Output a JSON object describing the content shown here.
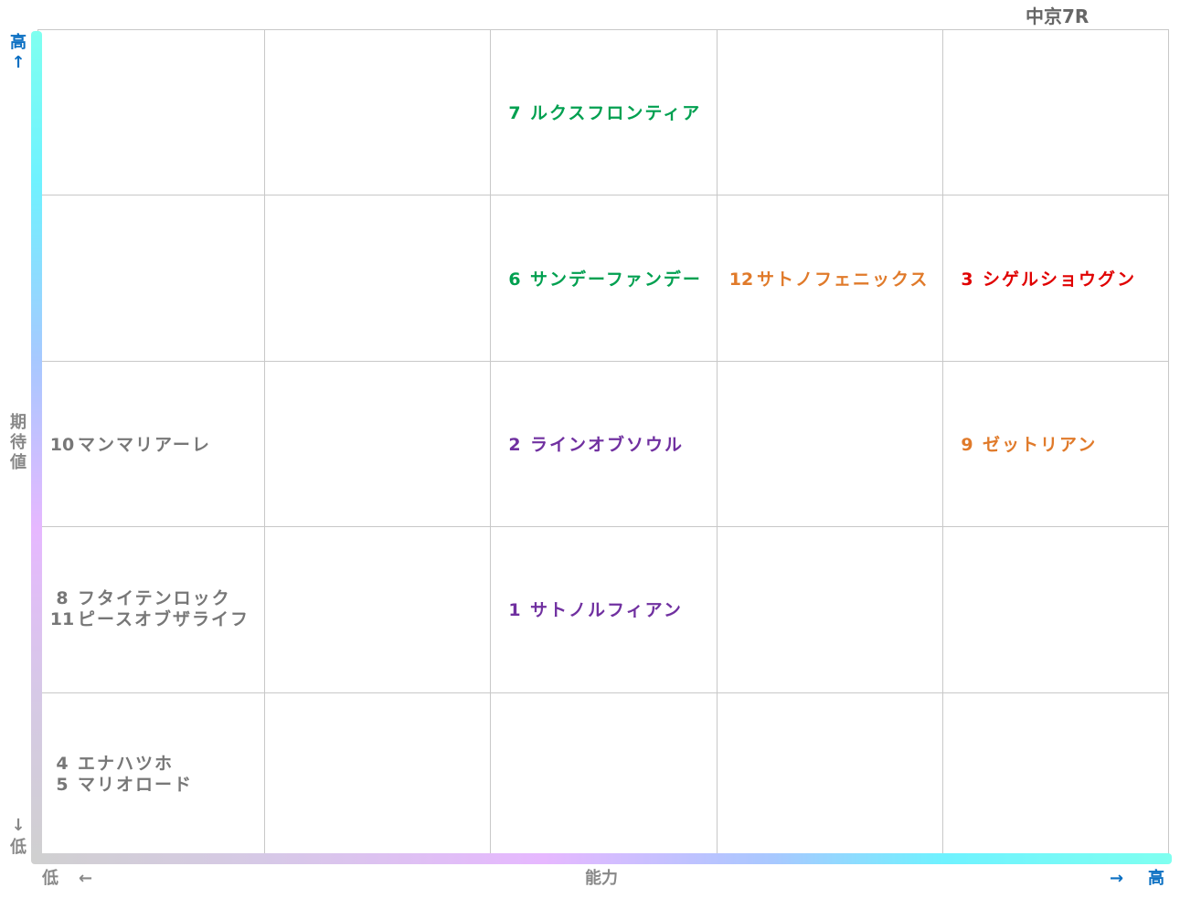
{
  "title": "中京7R",
  "y_axis": {
    "high": "高↑",
    "label": [
      "期",
      "待",
      "値"
    ],
    "low_arrow": "↓",
    "low": "低"
  },
  "x_axis": {
    "low": "低",
    "low_arrow": "←",
    "label": "能力",
    "high_arrow": "→",
    "high": "高"
  },
  "colors": {
    "gray": "#777777",
    "purple": "#7030a0",
    "green": "#00a050",
    "orange": "#e07a2a",
    "red": "#e00000"
  },
  "chart_data": {
    "type": "table",
    "x_label": "能力",
    "y_label": "期待値",
    "columns": 5,
    "rows": 5,
    "entries": [
      {
        "number": "7",
        "name": "ルクスフロンティア",
        "col": 3,
        "row": 5,
        "line": 0,
        "color": "green"
      },
      {
        "number": "6",
        "name": "サンデーファンデー",
        "col": 3,
        "row": 4,
        "line": 0,
        "color": "green"
      },
      {
        "number": "12",
        "name": "サトノフェニックス",
        "col": 4,
        "row": 4,
        "line": 0,
        "color": "orange"
      },
      {
        "number": "3",
        "name": "シゲルショウグン",
        "col": 5,
        "row": 4,
        "line": 0,
        "color": "red"
      },
      {
        "number": "10",
        "name": "マンマリアーレ",
        "col": 1,
        "row": 3,
        "line": 0,
        "color": "gray"
      },
      {
        "number": "2",
        "name": "ラインオブソウル",
        "col": 3,
        "row": 3,
        "line": 0,
        "color": "purple"
      },
      {
        "number": "9",
        "name": "ゼットリアン",
        "col": 5,
        "row": 3,
        "line": 0,
        "color": "orange"
      },
      {
        "number": "8",
        "name": "フタイテンロック",
        "col": 1,
        "row": 2,
        "line": 0,
        "color": "gray"
      },
      {
        "number": "11",
        "name": "ピースオブザライフ",
        "col": 1,
        "row": 2,
        "line": 1,
        "color": "gray"
      },
      {
        "number": "1",
        "name": "サトノルフィアン",
        "col": 3,
        "row": 2,
        "line": 0,
        "color": "purple"
      },
      {
        "number": "4",
        "name": "エナハツホ",
        "col": 1,
        "row": 1,
        "line": 0,
        "color": "gray"
      },
      {
        "number": "5",
        "name": "マリオロード",
        "col": 1,
        "row": 1,
        "line": 1,
        "color": "gray"
      }
    ]
  }
}
